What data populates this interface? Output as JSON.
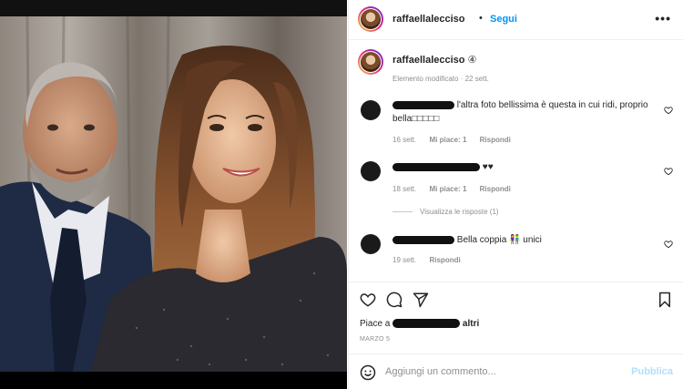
{
  "header": {
    "username": "raffaellalecciso",
    "separator": "•",
    "follow_label": "Segui",
    "more_label": "•••"
  },
  "caption": {
    "username": "raffaellalecciso",
    "suffix": " ④",
    "edited_label": "Elemento modificato · 22 sett."
  },
  "comments": [
    {
      "text": "l'altra foto bellissima è questa in cui ridi, proprio bella□□□□□",
      "time": "16 sett.",
      "likes": "Mi piace: 1",
      "reply": "Rispondi"
    },
    {
      "text": "♥♥",
      "time": "18 sett.",
      "likes": "Mi piace: 1",
      "reply": "Rispondi"
    },
    {
      "text": "Bella coppia 👫 unici",
      "time": "19 sett.",
      "reply": "Rispondi"
    }
  ],
  "view_replies": "Visualizza le risposte (1)",
  "likes": {
    "prefix": "Piace a",
    "suffix": "altri"
  },
  "date": "MARZO 5",
  "add_comment": {
    "placeholder": "Aggiungi un commento...",
    "publish_label": "Pubblica"
  },
  "colors": {
    "link_blue": "#0095f6",
    "publish_disabled": "#b2dffc",
    "muted": "#8e8e8e",
    "text": "#262626"
  },
  "icons": [
    "heart-icon",
    "comment-icon",
    "share-icon",
    "bookmark-icon",
    "emoji-icon",
    "more-icon"
  ]
}
